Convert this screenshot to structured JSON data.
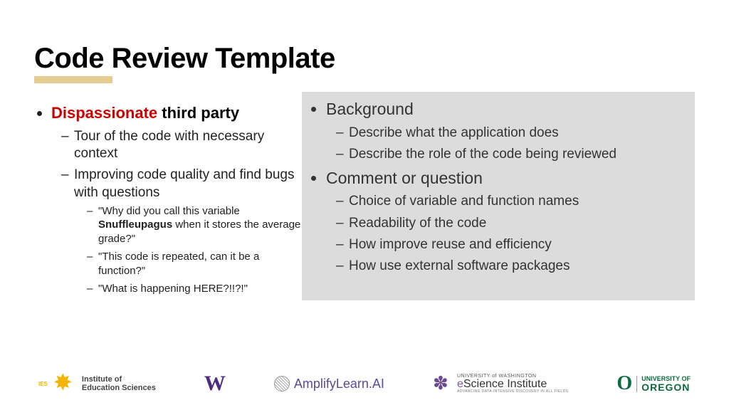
{
  "title": "Code Review Template",
  "left": {
    "head_hl": "Dispassionate",
    "head_rest": " third party",
    "sub1": "Tour of the code with necessary context",
    "sub2": "Improving code quality and find bugs with questions",
    "q1_a": "\"Why did you call this variable ",
    "q1_b": "Snuffleupagus",
    "q1_c": " when it stores the average grade?\"",
    "q2": "\"This code is repeated, can it be a function?\"",
    "q3": "\"What is happening HERE?!!?!\""
  },
  "right": {
    "h1": "Background",
    "h1s1": "Describe what the application does",
    "h1s2": "Describe the role of the code being reviewed",
    "h2": "Comment or question",
    "h2s1": "Choice of variable and function names",
    "h2s2": "Readability of the code",
    "h2s3": "How improve reuse and efficiency",
    "h2s4": "How use external software packages"
  },
  "logos": {
    "ies_label": "IES",
    "ies_l1": "Institute of",
    "ies_l2": "Education Sciences",
    "uw": "W",
    "amp": "AmplifyLearn.AI",
    "esci_top": "UNIVERSITY of WASHINGTON",
    "esci_main_e": "e",
    "esci_main_rest": "Science Institute",
    "esci_sub": "ADVANCING DATA-INTENSIVE DISCOVERY IN ALL FIELDS",
    "uo_o": "O",
    "uo_top": "UNIVERSITY OF",
    "uo_bot": "OREGON"
  }
}
